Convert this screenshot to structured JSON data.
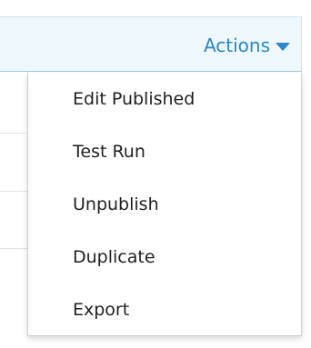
{
  "toolbar": {
    "actions_label": "Actions"
  },
  "menu": {
    "items": [
      {
        "label": "Edit Published"
      },
      {
        "label": "Test Run"
      },
      {
        "label": "Unpublish"
      },
      {
        "label": "Duplicate"
      },
      {
        "label": "Export"
      }
    ]
  },
  "colors": {
    "accent": "#2b87c7",
    "bar_background": "#eef7fc",
    "menu_text": "#1f1f1f"
  },
  "icons": {
    "actions_caret": "caret-down-icon"
  }
}
